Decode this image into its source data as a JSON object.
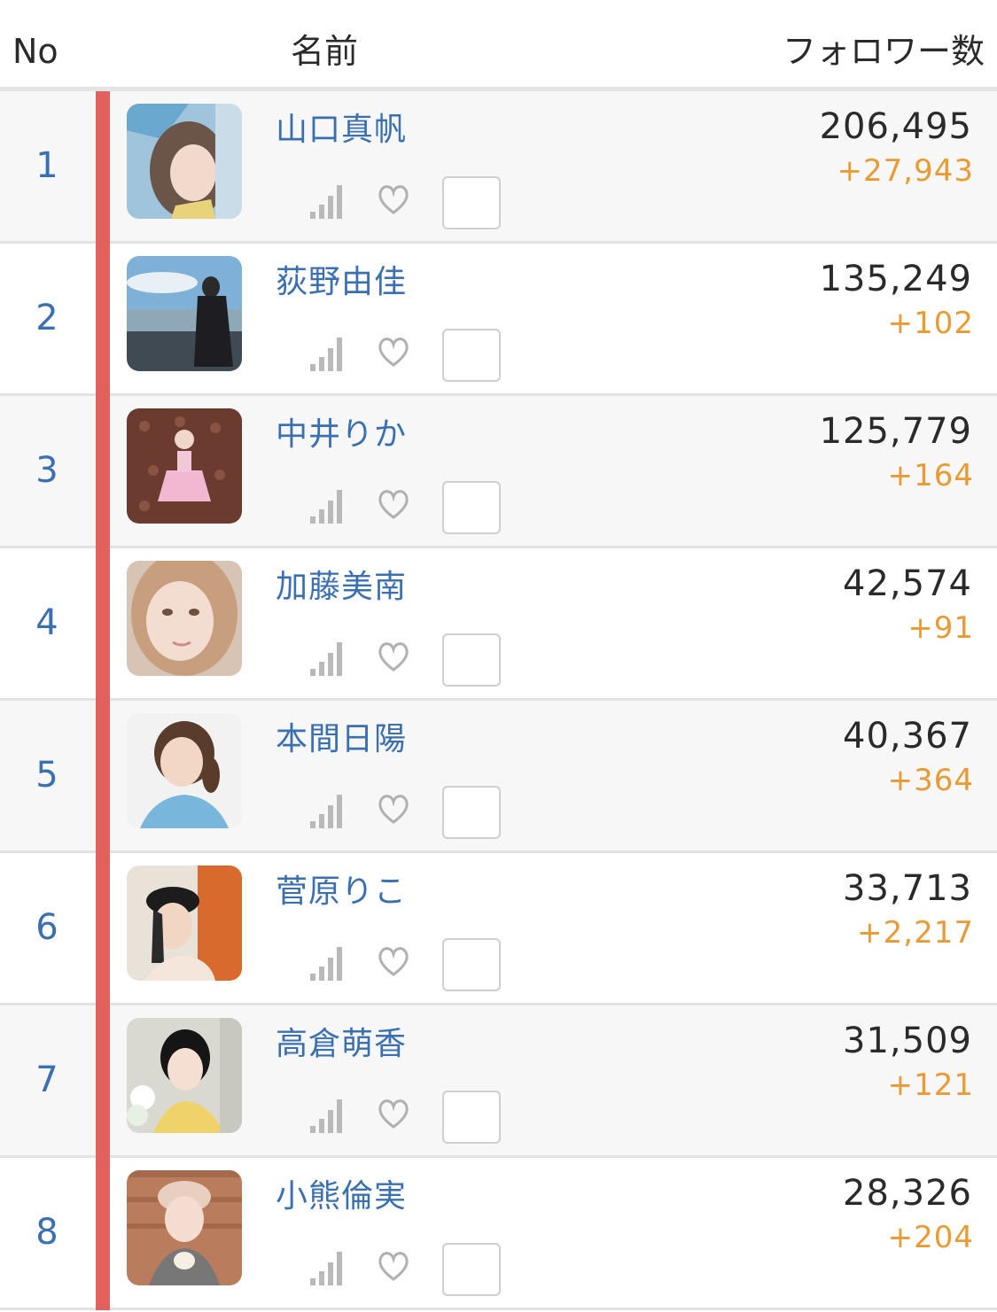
{
  "header": {
    "no": "No",
    "name": "名前",
    "followers": "フォロワー数"
  },
  "colors": {
    "accent_bar": "#e0615d",
    "name_link": "#3a6fb0",
    "delta": "#e89a34"
  },
  "rows": [
    {
      "rank": "1",
      "name": "山口真帆",
      "followers": "206,495",
      "delta": "+27,943"
    },
    {
      "rank": "2",
      "name": "荻野由佳",
      "followers": "135,249",
      "delta": "+102"
    },
    {
      "rank": "3",
      "name": "中井りか",
      "followers": "125,779",
      "delta": "+164"
    },
    {
      "rank": "4",
      "name": "加藤美南",
      "followers": "42,574",
      "delta": "+91"
    },
    {
      "rank": "5",
      "name": "本間日陽",
      "followers": "40,367",
      "delta": "+364"
    },
    {
      "rank": "6",
      "name": "菅原りこ",
      "followers": "33,713",
      "delta": "+2,217"
    },
    {
      "rank": "7",
      "name": "高倉萌香",
      "followers": "31,509",
      "delta": "+121"
    },
    {
      "rank": "8",
      "name": "小熊倫実",
      "followers": "28,326",
      "delta": "+204"
    }
  ],
  "icons": {
    "signal": "signal-bars-icon",
    "heart": "heart-outline-icon",
    "checkbox": "checkbox"
  }
}
